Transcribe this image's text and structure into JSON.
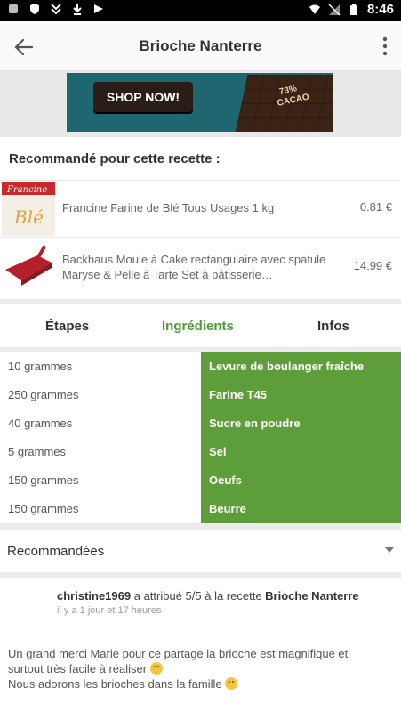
{
  "status_bar": {
    "time": "8:46"
  },
  "appbar": {
    "title": "Brioche Nanterre"
  },
  "banner": {
    "button": "SHOP NOW!",
    "choc_label": "73% CACAO"
  },
  "recommended": {
    "heading": "Recommandé pour cette recette :",
    "products": [
      {
        "name": "Francine Farine de Blé Tous Usages 1 kg",
        "price": "0.81 €"
      },
      {
        "name": "Backhaus Moule à Cake rectangulaire avec spatule Maryse & Pelle à Tarte Set à pâtisserie…",
        "price": "14.99 €"
      }
    ]
  },
  "tabs": [
    {
      "label": "Étapes"
    },
    {
      "label": "Ingrédients"
    },
    {
      "label": "Infos"
    }
  ],
  "ingredients": [
    {
      "qty": "10 grammes",
      "item": "Levure de boulanger fraîche"
    },
    {
      "qty": "250 grammes",
      "item": "Farine T45"
    },
    {
      "qty": "40 grammes",
      "item": "Sucre en poudre"
    },
    {
      "qty": "5 grammes",
      "item": "Sel"
    },
    {
      "qty": "150 grammes",
      "item": "Oeufs"
    },
    {
      "qty": "150 grammes",
      "item": "Beurre"
    }
  ],
  "dropdown": {
    "selected": "Recommandées"
  },
  "comment": {
    "author": "christine1969",
    "middle": "a attribué 5/5 à la recette",
    "recipe": "Brioche Nanterre",
    "time": "il y a 1 jour et 17 heures",
    "line1": "Un grand merci Marie  pour ce partage la brioche est magnifique  et",
    "line2": "surtout très  facile à réaliser",
    "line3": "Nous adorons les brioches dans la famille"
  },
  "colors": {
    "accent": "#5e9e3a",
    "active_tab": "#4c9b3a"
  }
}
